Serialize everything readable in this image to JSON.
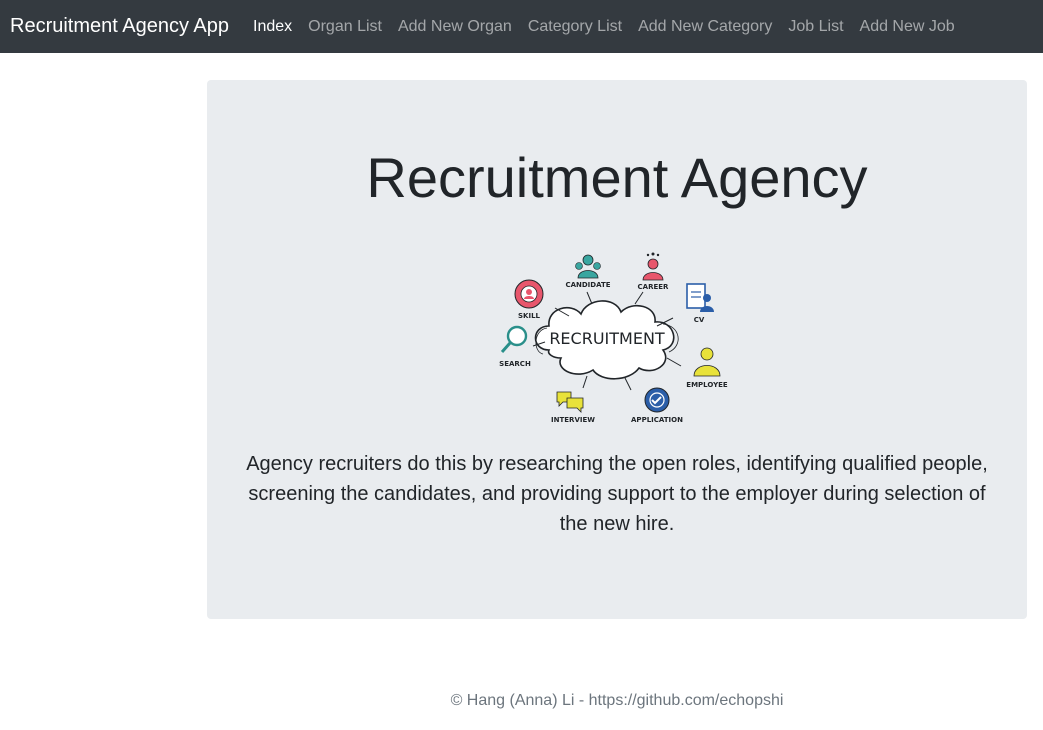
{
  "navbar": {
    "brand": "Recruitment Agency App",
    "links": [
      {
        "label": "Index",
        "active": true
      },
      {
        "label": "Organ List",
        "active": false
      },
      {
        "label": "Add New Organ",
        "active": false
      },
      {
        "label": "Category List",
        "active": false
      },
      {
        "label": "Add New Category",
        "active": false
      },
      {
        "label": "Job List",
        "active": false
      },
      {
        "label": "Add New Job",
        "active": false
      }
    ]
  },
  "hero": {
    "title": "Recruitment Agency",
    "description": "Agency recruiters do this by researching the open roles, identifying qualified people, screening the candidates, and providing support to the employer during selection of the new hire.",
    "illustration": {
      "center_label": "RECRUITMENT",
      "labels": {
        "candidate": "CANDIDATE",
        "career": "CAREER",
        "skill": "SKILL",
        "cv": "CV",
        "search": "SEARCH",
        "employee": "EMPLOYEE",
        "interview": "INTERVIEW",
        "application": "APPLICATION"
      }
    }
  },
  "footer": {
    "text": "© Hang (Anna) Li - https://github.com/echopshi"
  }
}
